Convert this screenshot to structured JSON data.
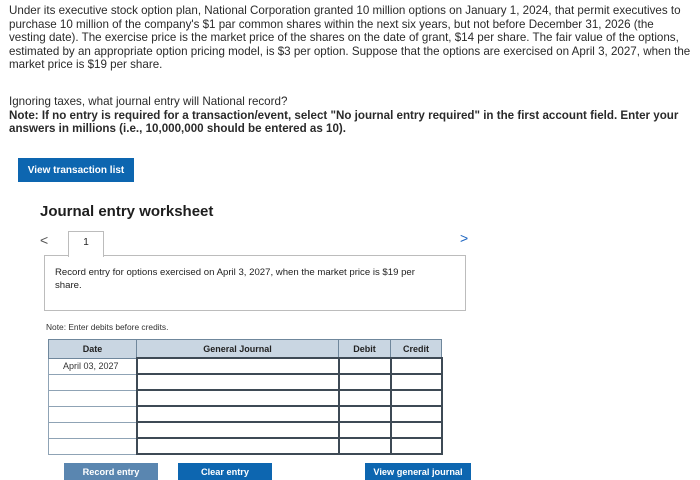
{
  "problem": {
    "text": "Under its executive stock option plan, National Corporation granted 10 million options on January 1, 2024, that permit executives to purchase 10 million of the company's $1 par common shares within the next six years, but not before December 31, 2026 (the vesting date). The exercise price is the market price of the shares on the date of grant, $14 per share. The fair value of the options, estimated by an appropriate option pricing model, is $3 per option. Suppose that the options are exercised on April 3, 2027, when the market price is $19 per share."
  },
  "question": {
    "prompt": "Ignoring taxes, what journal entry will National record?",
    "note": "Note: If no entry is required for a transaction/event, select \"No journal entry required\" in the first account field. Enter your answers in millions (i.e., 10,000,000 should be entered as 10)."
  },
  "buttons": {
    "view_transaction_list": "View transaction list",
    "record_entry": "Record entry",
    "clear_entry": "Clear entry",
    "view_general_journal": "View general journal"
  },
  "worksheet": {
    "title": "Journal entry worksheet",
    "nav_prev": "<",
    "nav_next": ">",
    "tab_number": "1",
    "instruction": "Record entry for options exercised on April 3, 2027, when the market price is $19 per share.",
    "note": "Note: Enter debits before credits."
  },
  "journal": {
    "headers": {
      "date": "Date",
      "account": "General Journal",
      "debit": "Debit",
      "credit": "Credit"
    },
    "rows": [
      {
        "date": "April 03, 2027"
      },
      {
        "date": ""
      },
      {
        "date": ""
      },
      {
        "date": ""
      },
      {
        "date": ""
      },
      {
        "date": ""
      }
    ]
  },
  "colors": {
    "button_blue": "#0d66b0",
    "table_header": "#c9d6e2"
  }
}
